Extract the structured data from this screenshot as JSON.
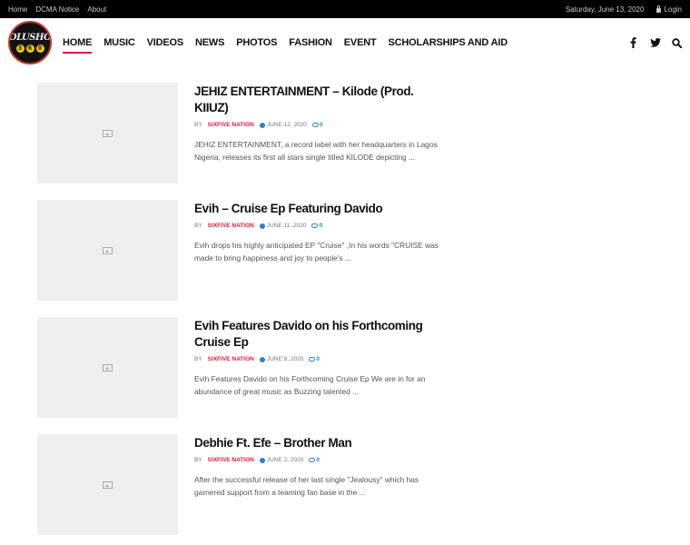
{
  "topbar": {
    "links": [
      "Home",
      "DCMA Notice",
      "About"
    ],
    "date": "Saturday, June 13, 2020",
    "login": "Login"
  },
  "logo": {
    "line1": "OLUSHO",
    "line2": [
      "3",
      "6",
      "0"
    ]
  },
  "nav": {
    "items": [
      "HOME",
      "MUSIC",
      "VIDEOS",
      "NEWS",
      "PHOTOS",
      "FASHION",
      "EVENT",
      "SCHOLARSHIPS AND AID"
    ],
    "active": "HOME"
  },
  "social": [
    "facebook-icon",
    "twitter-icon",
    "search-icon"
  ],
  "colors": {
    "accent": "#e0183b",
    "link_blue": "#2a7fd4",
    "topbar": "#000000"
  },
  "posts": [
    {
      "title": "JEHIZ ENTERTAINMENT – Kilode (Prod. KIIUZ)",
      "author": "SIXFIVE NATION",
      "date": "JUNE 12, 2020",
      "comments": "0",
      "excerpt": "JEHIZ ENTERTAINMENT, a record label with her headquarters in Lagos Nigeria, releases its first all stars single titled KILODE depicting ..."
    },
    {
      "title": "Evih – Cruise Ep Featuring Davido",
      "author": "SIXFIVE NATION",
      "date": "JUNE 11, 2020",
      "comments": "0",
      "excerpt": "Evih drops his highly anticipated EP \"Cruise\" ,In his words \"CRUISE was made to bring happiness and joy to people's ..."
    },
    {
      "title": "Evih Features Davido on his Forthcoming Cruise Ep",
      "author": "SIXFIVE NATION",
      "date": "JUNE 8, 2020",
      "comments": "0",
      "excerpt": "Evih Features Davido on his Forthcoming Cruise Ep We are in for an abundance of great music as Buzzing talented ..."
    },
    {
      "title": "Debhie Ft. Efe – Brother Man",
      "author": "SIXFIVE NATION",
      "date": "JUNE 2, 2020",
      "comments": "0",
      "excerpt": "After the successful release of her last single \"Jealousy\" which has garnered support from a teaming fan base in the ..."
    }
  ]
}
